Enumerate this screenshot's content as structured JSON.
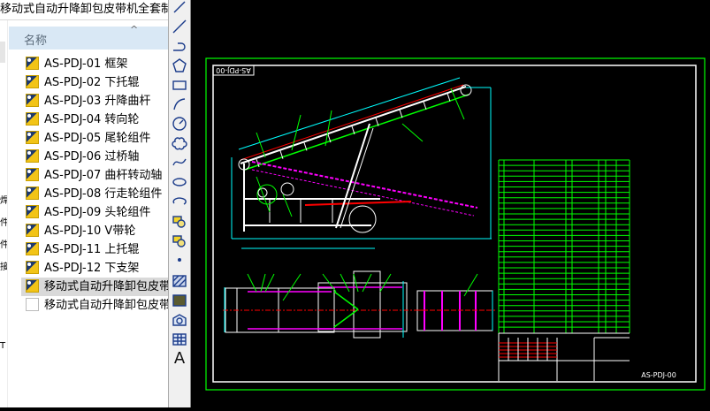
{
  "explorer": {
    "path": "移动式自动升降卸包皮带机全套制作",
    "nav_chars": [
      "焊",
      "件",
      "件",
      "接",
      "T"
    ],
    "column_header": "名称",
    "files": [
      {
        "name": "AS-PDJ-01 框架",
        "icon": "dwg-file-icon"
      },
      {
        "name": "AS-PDJ-02 下托辊",
        "icon": "dwg-file-icon"
      },
      {
        "name": "AS-PDJ-03 升降曲杆",
        "icon": "dwg-file-icon"
      },
      {
        "name": "AS-PDJ-04 转向轮",
        "icon": "dwg-file-icon"
      },
      {
        "name": "AS-PDJ-05 尾轮组件",
        "icon": "dwg-file-icon"
      },
      {
        "name": "AS-PDJ-06 过桥轴",
        "icon": "dwg-file-icon"
      },
      {
        "name": "AS-PDJ-07 曲杆转动轴",
        "icon": "dwg-file-icon"
      },
      {
        "name": "AS-PDJ-08 行走轮组件",
        "icon": "dwg-file-icon"
      },
      {
        "name": "AS-PDJ-09 头轮组件",
        "icon": "dwg-file-icon"
      },
      {
        "name": "AS-PDJ-10 V带轮",
        "icon": "dwg-file-icon"
      },
      {
        "name": "AS-PDJ-11 上托辊",
        "icon": "dwg-file-icon"
      },
      {
        "name": "AS-PDJ-12 下支架",
        "icon": "dwg-file-icon"
      },
      {
        "name": "移动式自动升降卸包皮带机",
        "icon": "dwg-file-icon",
        "selected": true
      },
      {
        "name": "移动式自动升降卸包皮带机",
        "icon": "blank-file-icon"
      }
    ]
  },
  "toolbar": [
    "line",
    "polyline",
    "polyline-arc",
    "polygon",
    "rectangle",
    "arc",
    "circle",
    "revision-cloud",
    "spline",
    "ellipse",
    "ellipse-arc",
    "insert-block",
    "make-block",
    "point",
    "hatch",
    "gradient",
    "region",
    "table",
    "multiline-text"
  ],
  "drawing": {
    "title_tag": "AS-PDJ-00",
    "drawing_number": "AS-PDJ-00",
    "colors": {
      "border": "#00ff00",
      "frame": "#ffffff",
      "dimension": "#00ffff",
      "part": "#ff00ff",
      "centerline": "#ff0000"
    }
  }
}
